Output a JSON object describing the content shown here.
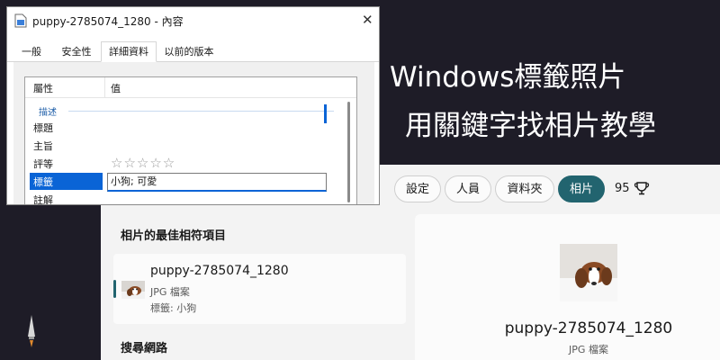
{
  "banner": {
    "title_line1": "Windows標籤照片",
    "title_line2": "用關鍵字找相片教學"
  },
  "properties_dialog": {
    "title": "puppy-2785074_1280 - 內容",
    "tabs": [
      "一般",
      "安全性",
      "詳細資料",
      "以前的版本"
    ],
    "active_tab": "詳細資料",
    "columns": {
      "name": "屬性",
      "value": "值"
    },
    "group": "描述",
    "rows": [
      {
        "name": "標題",
        "value": ""
      },
      {
        "name": "主旨",
        "value": ""
      },
      {
        "name": "評等",
        "value": "☆☆☆☆☆"
      },
      {
        "name": "標籤",
        "value": "小狗; 可愛"
      },
      {
        "name": "註解",
        "value": ""
      }
    ],
    "selected_row": "標籤"
  },
  "search_panel": {
    "filters": [
      {
        "label": "設定"
      },
      {
        "label": "人員"
      },
      {
        "label": "資料夾"
      },
      {
        "label": "相片"
      }
    ],
    "active_filter": "相片",
    "rewards_points": "95",
    "best_match_heading": "相片的最佳相符項目",
    "result": {
      "name": "puppy-2785074_1280",
      "type": "JPG 檔案",
      "tags": "標籤: 小狗"
    },
    "search_web_heading": "搜尋網路",
    "preview": {
      "name": "puppy-2785074_1280",
      "type": "JPG 檔案"
    }
  },
  "colors": {
    "background": "#1e1c27",
    "accent": "#22646f",
    "selection": "#0a64d6"
  },
  "icons": [
    "file-icon",
    "close-icon",
    "trophy-icon",
    "taskbar-app-icon"
  ]
}
